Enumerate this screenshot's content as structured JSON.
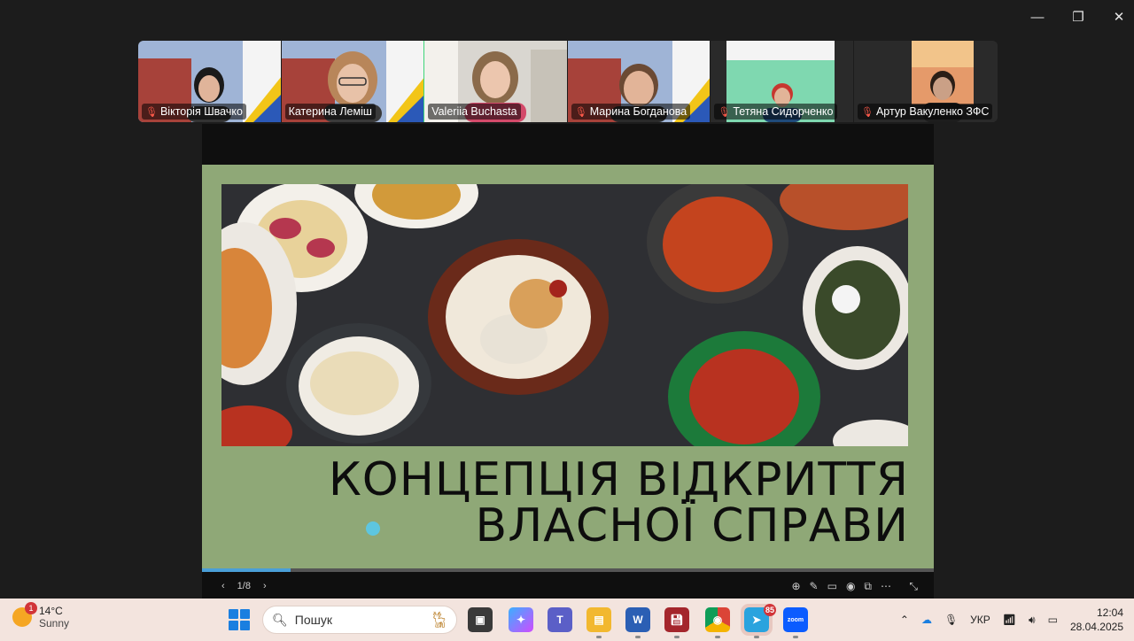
{
  "participants": [
    {
      "name": "Вікторія Швачко",
      "muted": true
    },
    {
      "name": "Катерина Леміш",
      "muted": false,
      "active": true
    },
    {
      "name": "Valeriia Buchasta",
      "muted": false
    },
    {
      "name": "Марина Богданова",
      "muted": true
    },
    {
      "name": "Тетяна Сидорченко",
      "muted": true
    },
    {
      "name": "Артур Вакуленко ЗФС",
      "muted": true
    }
  ],
  "slide": {
    "title_line1": "КОНЦЕПЦІЯ ВІДКРИТТЯ",
    "title_line2": "ВЛАСНОЇ СПРАВИ",
    "page": "1/8",
    "background_color": "#8fa877"
  },
  "taskbar": {
    "weather_temp": "14°C",
    "weather_desc": "Sunny",
    "weather_badge": "1",
    "search_placeholder": "Пошук",
    "telegram_badge": "85",
    "language": "УКР",
    "time": "12:04",
    "date": "28.04.2025",
    "zoom_label": "zoom"
  },
  "window_controls": {
    "minimize": "—",
    "maximize": "❐",
    "close": "✕"
  }
}
